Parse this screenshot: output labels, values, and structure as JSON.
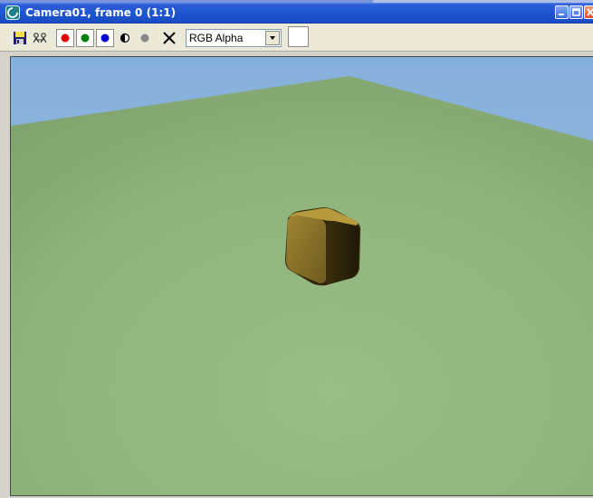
{
  "window": {
    "title": "Camera01, frame 0 (1:1)",
    "icon": "3dsmax-app-icon"
  },
  "titlebar_buttons": [
    "minimize-icon",
    "maximize-icon",
    "close-icon"
  ],
  "toolbar": {
    "buttons": [
      {
        "name": "save-image-button",
        "icon": "floppy-disk-icon"
      },
      {
        "name": "clone-window-button",
        "icon": "clone-icon"
      },
      {
        "name": "red-channel-toggle",
        "icon": "red-dot-icon",
        "color": "#e00000"
      },
      {
        "name": "green-channel-toggle",
        "icon": "green-dot-icon",
        "color": "#008000"
      },
      {
        "name": "blue-channel-toggle",
        "icon": "blue-dot-icon",
        "color": "#0000d0"
      },
      {
        "name": "monochrome-toggle",
        "icon": "half-circle-icon"
      },
      {
        "name": "alpha-display-toggle",
        "icon": "gray-dot-icon",
        "color": "#888888"
      },
      {
        "name": "clear-button",
        "icon": "x-icon"
      }
    ],
    "channel_select": {
      "value": "RGB Alpha"
    },
    "color_swatch": "#ffffff"
  },
  "scene": {
    "sky_color": "#8ab4dc",
    "ground_color": "#8bb27a",
    "object": "rounded-cube",
    "object_color": "#9a7e2e"
  }
}
